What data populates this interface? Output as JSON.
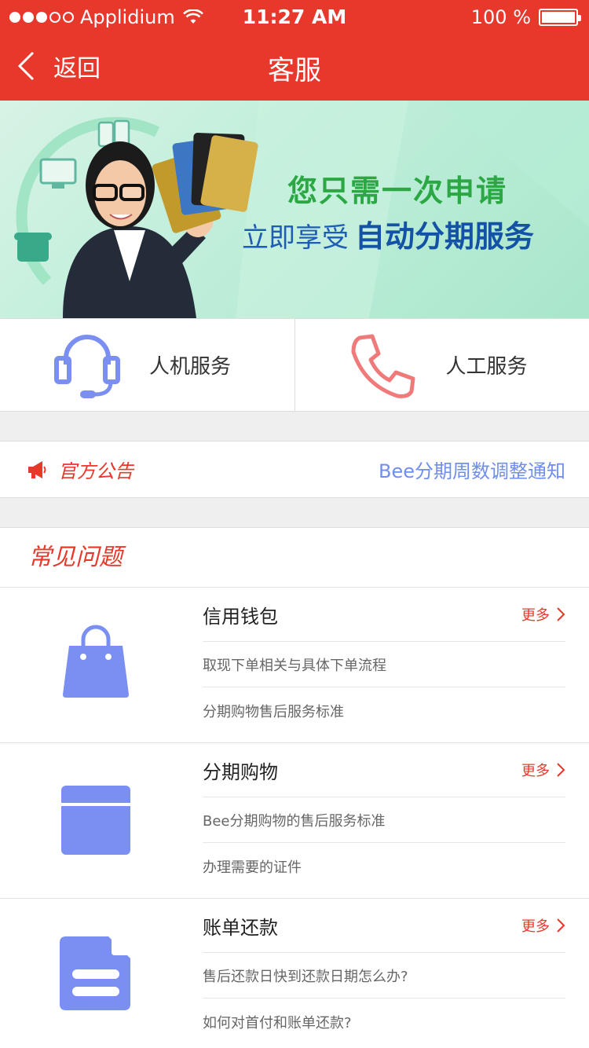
{
  "status": {
    "carrier": "Applidium",
    "time": "11:27 AM",
    "battery": "100 %"
  },
  "nav": {
    "back_label": "返回",
    "title": "客服"
  },
  "banner": {
    "line1": "您只需一次申请",
    "line2_prefix": "立即享受",
    "line2_emphasis": "自动分期服务"
  },
  "services": [
    {
      "label": "人机服务",
      "icon": "headset-icon",
      "color": "#7b8ff3"
    },
    {
      "label": "人工服务",
      "icon": "phone-icon",
      "color": "#f07a7a"
    }
  ],
  "notice": {
    "label": "官方公告",
    "link": "Bee分期周数调整通知",
    "icon": "megaphone-icon"
  },
  "faq": {
    "title": "常见问题",
    "more_label": "更多",
    "groups": [
      {
        "category": "信用钱包",
        "icon": "shopping-bag-icon",
        "questions": [
          "取现下单相关与具体下单流程",
          "分期购物售后服务标准"
        ]
      },
      {
        "category": "分期购物",
        "icon": "calendar-card-icon",
        "questions": [
          "Bee分期购物的售后服务标准",
          "办理需要的证件"
        ]
      },
      {
        "category": "账单还款",
        "icon": "document-icon",
        "questions": [
          "售后还款日快到还款日期怎么办?",
          "如何对首付和账单还款?"
        ]
      }
    ]
  },
  "colors": {
    "primary": "#e8382b",
    "icon_blue": "#7b8ff3",
    "link_blue": "#6f8ef0"
  }
}
